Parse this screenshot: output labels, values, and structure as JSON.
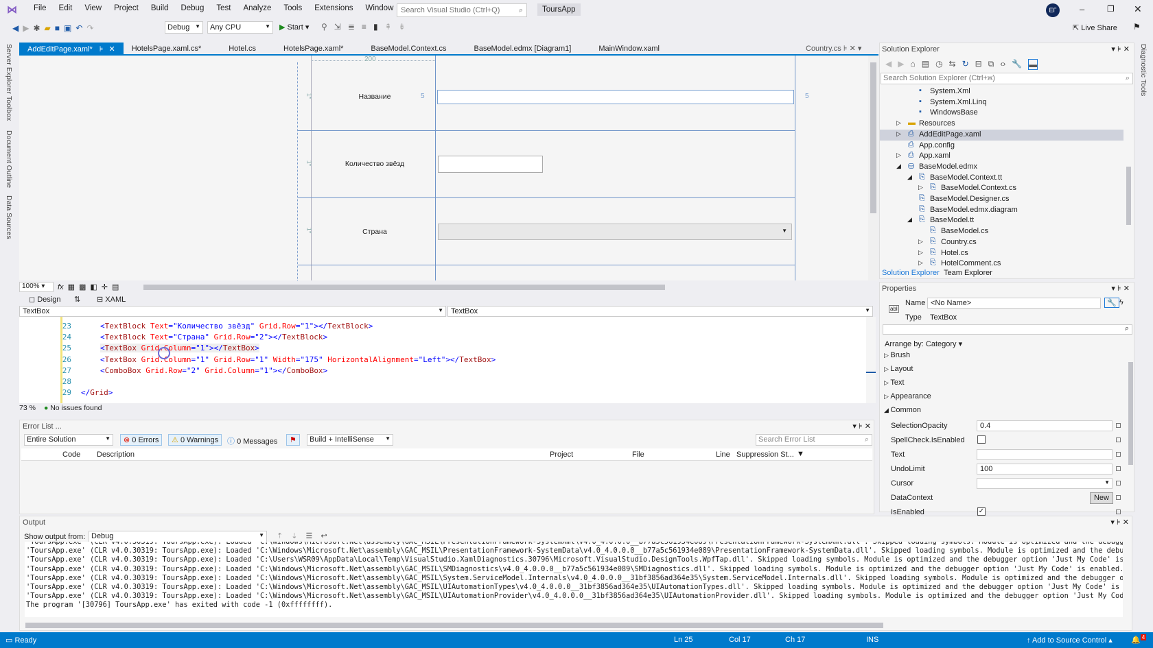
{
  "menu": [
    "File",
    "Edit",
    "View",
    "Project",
    "Build",
    "Debug",
    "Test",
    "Analyze",
    "Tools",
    "Extensions",
    "Window",
    "Help"
  ],
  "search_placeholder": "Search Visual Studio (Ctrl+Q)",
  "solution_name": "ToursApp",
  "user_initials": "EГ",
  "toolbar": {
    "config": "Debug",
    "platform": "Any CPU",
    "start": "Start",
    "live_share": "Live Share"
  },
  "left_strip": [
    "Server Explorer",
    "Toolbox",
    "Document Outline",
    "Data Sources"
  ],
  "right_strip": "Diagnostic Tools",
  "tabs": [
    {
      "label": "AddEditPage.xaml*",
      "active": true
    },
    {
      "label": "HotelsPage.xaml.cs*"
    },
    {
      "label": "Hotel.cs"
    },
    {
      "label": "HotelsPage.xaml*"
    },
    {
      "label": "BaseModel.Context.cs"
    },
    {
      "label": "BaseModel.edmx [Diagram1]"
    },
    {
      "label": "MainWindow.xaml"
    }
  ],
  "preview_tab": "Country.cs",
  "designer": {
    "column_width": "200",
    "margin_left": "5",
    "margin_right": "5",
    "row_marker": "1*",
    "labels": [
      "Название",
      "Количество звёзд",
      "Страна"
    ],
    "zoom": "100%"
  },
  "view_tabs": {
    "design": "Design",
    "xaml": "XAML"
  },
  "nav": {
    "left": "TextBox",
    "right": "TextBox"
  },
  "code": {
    "lines": [
      {
        "n": "23",
        "tokens": [
          [
            "<",
            "pun"
          ],
          [
            "TextBlock",
            "tag"
          ],
          [
            " Text",
            "attr"
          ],
          [
            "=",
            "pun"
          ],
          [
            "\"Количество звёзд\"",
            "val"
          ],
          [
            " Grid.Row",
            "attr"
          ],
          [
            "=",
            "pun"
          ],
          [
            "\"1\"",
            "val"
          ],
          [
            "></",
            "pun"
          ],
          [
            "TextBlock",
            "tag"
          ],
          [
            ">",
            "pun"
          ]
        ]
      },
      {
        "n": "24",
        "tokens": [
          [
            "<",
            "pun"
          ],
          [
            "TextBlock",
            "tag"
          ],
          [
            " Text",
            "attr"
          ],
          [
            "=",
            "pun"
          ],
          [
            "\"Страна\"",
            "val"
          ],
          [
            " Grid.Row",
            "attr"
          ],
          [
            "=",
            "pun"
          ],
          [
            "\"2\"",
            "val"
          ],
          [
            "></",
            "pun"
          ],
          [
            "TextBlock",
            "tag"
          ],
          [
            ">",
            "pun"
          ]
        ]
      },
      {
        "n": "25",
        "tokens": [
          [
            "<",
            "pun"
          ],
          [
            "TextBox",
            "tag"
          ],
          [
            " Grid.Column",
            "attr"
          ],
          [
            "=",
            "pun"
          ],
          [
            "\"1\"",
            "val"
          ],
          [
            "></",
            "pun"
          ],
          [
            "TextBox",
            "tag"
          ],
          [
            ">",
            "pun"
          ]
        ]
      },
      {
        "n": "26",
        "tokens": [
          [
            "<",
            "pun"
          ],
          [
            "TextBox",
            "tag"
          ],
          [
            " Grid.Column",
            "attr"
          ],
          [
            "=",
            "pun"
          ],
          [
            "\"1\"",
            "val"
          ],
          [
            " Grid.Row",
            "attr"
          ],
          [
            "=",
            "pun"
          ],
          [
            "\"1\"",
            "val"
          ],
          [
            " Width",
            "attr"
          ],
          [
            "=",
            "pun"
          ],
          [
            "\"175\"",
            "val"
          ],
          [
            " HorizontalAlignment",
            "attr"
          ],
          [
            "=",
            "pun"
          ],
          [
            "\"Left\"",
            "val"
          ],
          [
            "></",
            "pun"
          ],
          [
            "TextBox",
            "tag"
          ],
          [
            ">",
            "pun"
          ]
        ]
      },
      {
        "n": "27",
        "tokens": [
          [
            "<",
            "pun"
          ],
          [
            "ComboBox",
            "tag"
          ],
          [
            " Grid.Row",
            "attr"
          ],
          [
            "=",
            "pun"
          ],
          [
            "\"2\"",
            "val"
          ],
          [
            " Grid.Column",
            "attr"
          ],
          [
            "=",
            "pun"
          ],
          [
            "\"1\"",
            "val"
          ],
          [
            "></",
            "pun"
          ],
          [
            "ComboBox",
            "tag"
          ],
          [
            ">",
            "pun"
          ]
        ]
      },
      {
        "n": "28",
        "tokens": []
      },
      {
        "n": "29",
        "tokens": [
          [
            "</",
            "pun"
          ],
          [
            "Grid",
            "tag"
          ],
          [
            ">",
            "pun"
          ]
        ],
        "indent": 1
      }
    ],
    "zoom": "73 %",
    "issues": "No issues found"
  },
  "error_list": {
    "title": "Error List ...",
    "scope": "Entire Solution",
    "errors": "0 Errors",
    "warnings": "0 Warnings",
    "messages": "0 Messages",
    "source": "Build + IntelliSense",
    "search_placeholder": "Search Error List",
    "columns": [
      "Code",
      "Description",
      "Project",
      "File",
      "Line",
      "Suppression St..."
    ]
  },
  "output": {
    "title": "Output",
    "show_from_label": "Show output from:",
    "source": "Debug",
    "lines": [
      "'ToursApp.exe' (CLR v4.0.30319: ToursApp.exe): Loaded 'C:\\Windows\\Microsoft.Net\\assembly\\GAC_MSIL\\PresentationFramework-SystemXml\\v4.0_4.0.0.0__b77a5c561934e089\\PresentationFramework-SystemXml.dll'. Skipped loading symbols. Module is optimized and the debugger",
      "'ToursApp.exe' (CLR v4.0.30319: ToursApp.exe): Loaded 'C:\\Windows\\Microsoft.Net\\assembly\\GAC_MSIL\\PresentationFramework-SystemData\\v4.0_4.0.0.0__b77a5c561934e089\\PresentationFramework-SystemData.dll'. Skipped loading symbols. Module is optimized and the debugge",
      "'ToursApp.exe' (CLR v4.0.30319: ToursApp.exe): Loaded 'C:\\Users\\WSR09\\AppData\\Local\\Temp\\VisualStudio.XamlDiagnostics.30796\\Microsoft.VisualStudio.DesignTools.WpfTap.dll'. Skipped loading symbols. Module is optimized and the debugger option 'Just My Code' is er",
      "'ToursApp.exe' (CLR v4.0.30319: ToursApp.exe): Loaded 'C:\\Windows\\Microsoft.Net\\assembly\\GAC_MSIL\\SMDiagnostics\\v4.0_4.0.0.0__b77a5c561934e089\\SMDiagnostics.dll'. Skipped loading symbols. Module is optimized and the debugger option 'Just My Code' is enabled.",
      "'ToursApp.exe' (CLR v4.0.30319: ToursApp.exe): Loaded 'C:\\Windows\\Microsoft.Net\\assembly\\GAC_MSIL\\System.ServiceModel.Internals\\v4.0_4.0.0.0__31bf3856ad364e35\\System.ServiceModel.Internals.dll'. Skipped loading symbols. Module is optimized and the debugger opti",
      "'ToursApp.exe' (CLR v4.0.30319: ToursApp.exe): Loaded 'C:\\Windows\\Microsoft.Net\\assembly\\GAC_MSIL\\UIAutomationTypes\\v4.0_4.0.0.0__31bf3856ad364e35\\UIAutomationTypes.dll'. Skipped loading symbols. Module is optimized and the debugger option 'Just My Code' is ena",
      "'ToursApp.exe' (CLR v4.0.30319: ToursApp.exe): Loaded 'C:\\Windows\\Microsoft.Net\\assembly\\GAC_MSIL\\UIAutomationProvider\\v4.0_4.0.0.0__31bf3856ad364e35\\UIAutomationProvider.dll'. Skipped loading symbols. Module is optimized and the debugger option 'Just My Code'",
      "The program '[30796] ToursApp.exe' has exited with code -1 (0xffffffff)."
    ]
  },
  "solution_explorer": {
    "title": "Solution Explorer",
    "search_placeholder": "Search Solution Explorer (Ctrl+ж)",
    "items": [
      {
        "label": "System.Xml",
        "level": 3,
        "exp": ""
      },
      {
        "label": "System.Xml.Linq",
        "level": 3,
        "exp": ""
      },
      {
        "label": "WindowsBase",
        "level": 3,
        "exp": ""
      },
      {
        "label": "Resources",
        "level": 2,
        "exp": "▷"
      },
      {
        "label": "AddEditPage.xaml",
        "level": 2,
        "exp": "▷",
        "selected": true
      },
      {
        "label": "App.config",
        "level": 2,
        "exp": ""
      },
      {
        "label": "App.xaml",
        "level": 2,
        "exp": "▷"
      },
      {
        "label": "BaseModel.edmx",
        "level": 2,
        "exp": "◢"
      },
      {
        "label": "BaseModel.Context.tt",
        "level": 3,
        "exp": "◢"
      },
      {
        "label": "BaseModel.Context.cs",
        "level": 4,
        "exp": "▷"
      },
      {
        "label": "BaseModel.Designer.cs",
        "level": 3,
        "exp": ""
      },
      {
        "label": "BaseModel.edmx.diagram",
        "level": 3,
        "exp": ""
      },
      {
        "label": "BaseModel.tt",
        "level": 3,
        "exp": "◢"
      },
      {
        "label": "BaseModel.cs",
        "level": 4,
        "exp": ""
      },
      {
        "label": "Country.cs",
        "level": 4,
        "exp": "▷"
      },
      {
        "label": "Hotel.cs",
        "level": 4,
        "exp": "▷"
      },
      {
        "label": "HotelComment.cs",
        "level": 4,
        "exp": "▷"
      }
    ],
    "bottom_tabs": [
      "Solution Explorer",
      "Team Explorer"
    ]
  },
  "properties": {
    "title": "Properties",
    "name_label": "Name",
    "name_value": "<No Name>",
    "type_label": "Type",
    "type_value": "TextBox",
    "arrange": "Arrange by: Category",
    "categories": [
      "Brush",
      "Layout",
      "Text",
      "Appearance"
    ],
    "common": "Common",
    "rows": [
      {
        "label": "SelectionOpacity",
        "value": "0.4",
        "kind": "text"
      },
      {
        "label": "SpellCheck.IsEnabled",
        "value": "false",
        "kind": "check"
      },
      {
        "label": "Text",
        "value": "",
        "kind": "text"
      },
      {
        "label": "UndoLimit",
        "value": "100",
        "kind": "text"
      },
      {
        "label": "Cursor",
        "value": "",
        "kind": "select"
      },
      {
        "label": "DataContext",
        "value": "New",
        "kind": "button"
      },
      {
        "label": "IsEnabled",
        "value": "true",
        "kind": "check"
      }
    ]
  },
  "statusbar": {
    "ready": "Ready",
    "ln": "Ln 25",
    "col": "Col 17",
    "ch": "Ch 17",
    "ins": "INS",
    "source_control": "Add to Source Control",
    "notifications": "4"
  },
  "colors": {
    "accent": "#007acc",
    "chrome": "#eeeef2",
    "designer_grid": "#6f94c9"
  }
}
